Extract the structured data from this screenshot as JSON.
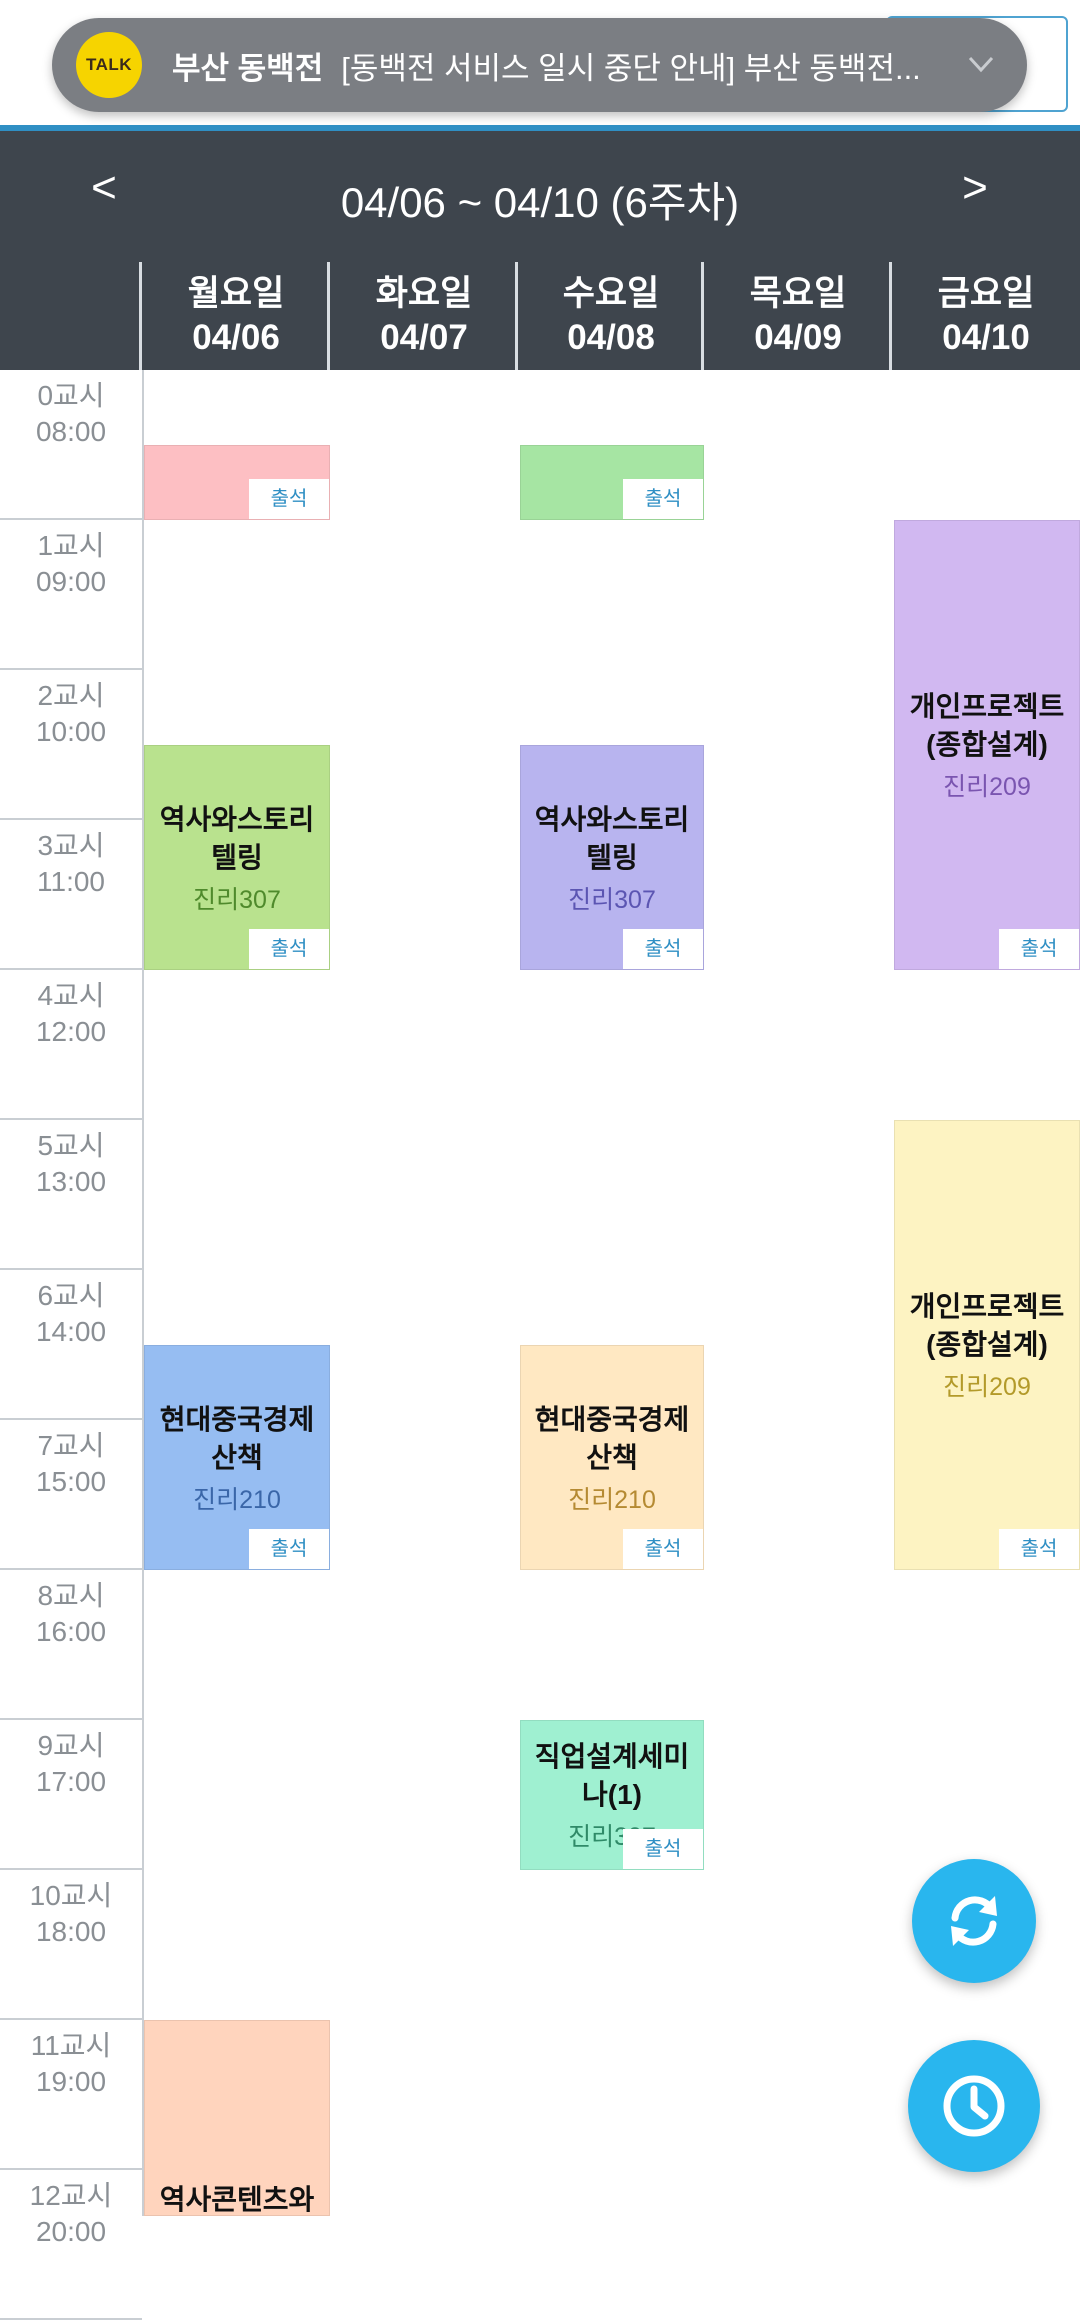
{
  "notification": {
    "app_icon_text": "TALK",
    "app_name": "부산 동백전",
    "message": "[동백전 서비스 일시 중단 안내]  부산 동백전..."
  },
  "week_nav": {
    "prev_label": "<",
    "title": "04/06 ~ 04/10 (6주차)",
    "next_label": ">"
  },
  "days": [
    {
      "name": "월요일",
      "date": "04/06"
    },
    {
      "name": "화요일",
      "date": "04/07"
    },
    {
      "name": "수요일",
      "date": "04/08"
    },
    {
      "name": "목요일",
      "date": "04/09"
    },
    {
      "name": "금요일",
      "date": "04/10"
    }
  ],
  "periods": [
    {
      "label": "0교시",
      "time": "08:00"
    },
    {
      "label": "1교시",
      "time": "09:00"
    },
    {
      "label": "2교시",
      "time": "10:00"
    },
    {
      "label": "3교시",
      "time": "11:00"
    },
    {
      "label": "4교시",
      "time": "12:00"
    },
    {
      "label": "5교시",
      "time": "13:00"
    },
    {
      "label": "6교시",
      "time": "14:00"
    },
    {
      "label": "7교시",
      "time": "15:00"
    },
    {
      "label": "8교시",
      "time": "16:00"
    },
    {
      "label": "9교시",
      "time": "17:00"
    },
    {
      "label": "10교시",
      "time": "18:00"
    },
    {
      "label": "11교시",
      "time": "19:00"
    },
    {
      "label": "12교시",
      "time": "20:00"
    }
  ],
  "courses": [
    {
      "day": 0,
      "start": 0.5,
      "end": 1,
      "name": "",
      "room": "",
      "bg": "#fdbfc3",
      "room_color": "#b55a60",
      "attendance": "출석"
    },
    {
      "day": 2,
      "start": 0.5,
      "end": 1,
      "name": "",
      "room": "",
      "bg": "#a6e5a3",
      "room_color": "#3f8a3c",
      "attendance": "출석"
    },
    {
      "day": 0,
      "start": 2.5,
      "end": 4,
      "name": "역사와스토리텔링",
      "room": "진리307",
      "bg": "#b9e28e",
      "room_color": "#4f8a2c",
      "attendance": "출석"
    },
    {
      "day": 2,
      "start": 2.5,
      "end": 4,
      "name": "역사와스토리텔링",
      "room": "진리307",
      "bg": "#b8b4ef",
      "room_color": "#5b55b2",
      "attendance": "출석"
    },
    {
      "day": 4,
      "start": 1,
      "end": 4,
      "name": "개인프로젝트(종합설계)",
      "room": "진리209",
      "bg": "#d1b8f1",
      "room_color": "#7a55b0",
      "attendance": "출석"
    },
    {
      "day": 4,
      "start": 5,
      "end": 8,
      "name": "개인프로젝트(종합설계)",
      "room": "진리209",
      "bg": "#fdf3c2",
      "room_color": "#b39a2a",
      "attendance": "출석"
    },
    {
      "day": 0,
      "start": 6.5,
      "end": 8,
      "name": "현대중국경제산책",
      "room": "진리210",
      "bg": "#96bdf2",
      "room_color": "#3a66a8",
      "attendance": "출석"
    },
    {
      "day": 2,
      "start": 6.5,
      "end": 8,
      "name": "현대중국경제산책",
      "room": "진리210",
      "bg": "#ffe8c2",
      "room_color": "#b58a32",
      "attendance": "출석"
    },
    {
      "day": 2,
      "start": 9,
      "end": 10,
      "name": "직업설계세미나(1)",
      "room": "진리307",
      "bg": "#9ff0d1",
      "room_color": "#2f8a68",
      "attendance": "출석"
    },
    {
      "day": 0,
      "start": 11,
      "end": 13,
      "name": "역사콘텐츠와스",
      "room": "",
      "bg": "#ffd4bd",
      "room_color": "#b56a3f",
      "attendance": ""
    }
  ],
  "fabs": {
    "refresh": "refresh-icon",
    "clock": "clock-icon"
  },
  "colors": {
    "header_bg": "#3e454d",
    "accent": "#2f8fc4",
    "fab": "#29b6ee"
  }
}
